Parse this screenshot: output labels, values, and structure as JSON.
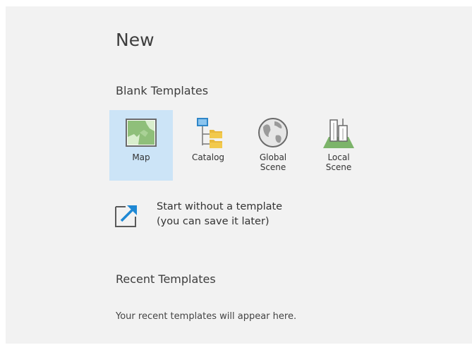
{
  "page": {
    "title": "New"
  },
  "blank_templates": {
    "heading": "Blank Templates",
    "items": [
      {
        "label": "Map",
        "icon": "map-icon",
        "selected": true
      },
      {
        "label": "Catalog",
        "icon": "catalog-icon",
        "selected": false
      },
      {
        "label": "Global\nScene",
        "icon": "globe-icon",
        "selected": false
      },
      {
        "label": "Local\nScene",
        "icon": "local-scene-icon",
        "selected": false
      }
    ]
  },
  "start_without_template": {
    "line1": "Start without a template",
    "line2": "(you can save it later)",
    "icon": "open-arrow-icon"
  },
  "recent_templates": {
    "heading": "Recent Templates",
    "empty_message": "Your recent templates will appear here."
  },
  "colors": {
    "panel_bg": "#f2f2f2",
    "selected_bg": "#cce4f7",
    "accent": "#1e88d4"
  }
}
